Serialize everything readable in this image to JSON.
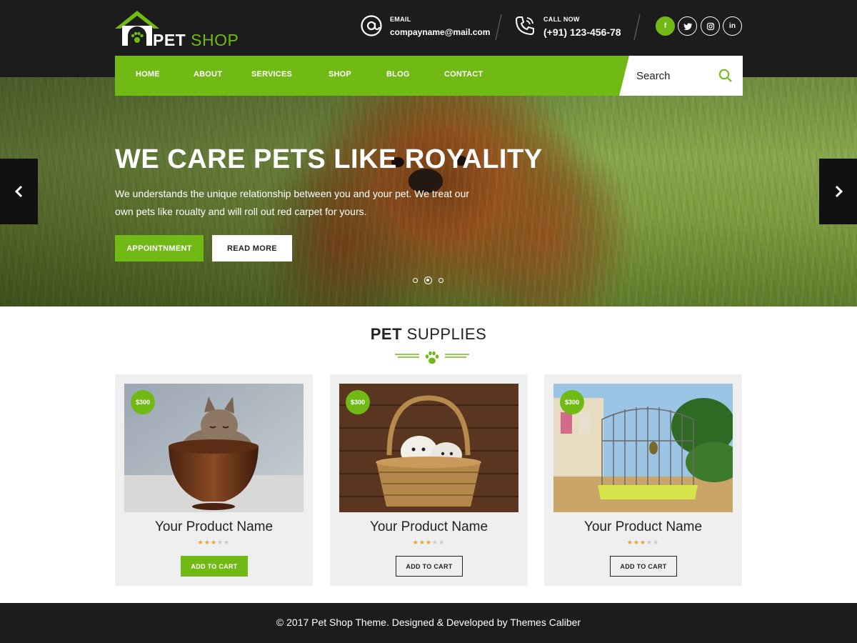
{
  "brand": {
    "name_bold": "PET",
    "name_light": "SHOP"
  },
  "contact": {
    "email_label": "EMAIL",
    "email_value": "compayname@mail.com",
    "call_label": "CALL NOW",
    "call_value": "(+91) 123-456-78"
  },
  "social": [
    {
      "icon": "facebook-icon",
      "glyph": "f"
    },
    {
      "icon": "twitter-icon",
      "glyph": "t"
    },
    {
      "icon": "instagram-icon",
      "glyph": "◎"
    },
    {
      "icon": "linkedin-icon",
      "glyph": "in"
    }
  ],
  "nav": {
    "items": [
      "HOME",
      "ABOUT",
      "SERVICES",
      "SHOP",
      "BLOG",
      "CONTACT"
    ],
    "search_placeholder": "Search"
  },
  "hero": {
    "title": "WE CARE PETS LIKE ROYALITY",
    "text": "We understands the unique relationship between you and your pet. We treat our own pets like roualty and will roll out red carpet for yours.",
    "primary_button": "APPOINTNMENT",
    "secondary_button": "READ MORE",
    "slide_count": 3,
    "active_slide": 2,
    "prev_icon": "chevron-left-icon",
    "next_icon": "chevron-right-icon"
  },
  "section": {
    "title_bold": "PET",
    "title_light": "SUPPLIES"
  },
  "products": [
    {
      "price": "$300",
      "name": "Your Product Name",
      "rating": 3,
      "max_rating": 5,
      "button": "ADD TO CART",
      "style": "filled",
      "image": "kitten-in-bowl"
    },
    {
      "price": "$300",
      "name": "Your Product Name",
      "rating": 3,
      "max_rating": 5,
      "button": "ADD TO CART",
      "style": "outline",
      "image": "puppies-in-basket"
    },
    {
      "price": "$300",
      "name": "Your Product Name",
      "rating": 3,
      "max_rating": 5,
      "button": "ADD TO CART",
      "style": "outline",
      "image": "bird-cage"
    }
  ],
  "footer": {
    "text": "© 2017  Pet Shop Theme. Designed & Developed by Themes Caliber"
  },
  "colors": {
    "accent": "#71b914",
    "dark": "#1c1c1c",
    "card_bg": "#efefef",
    "star": "#f0a020"
  }
}
